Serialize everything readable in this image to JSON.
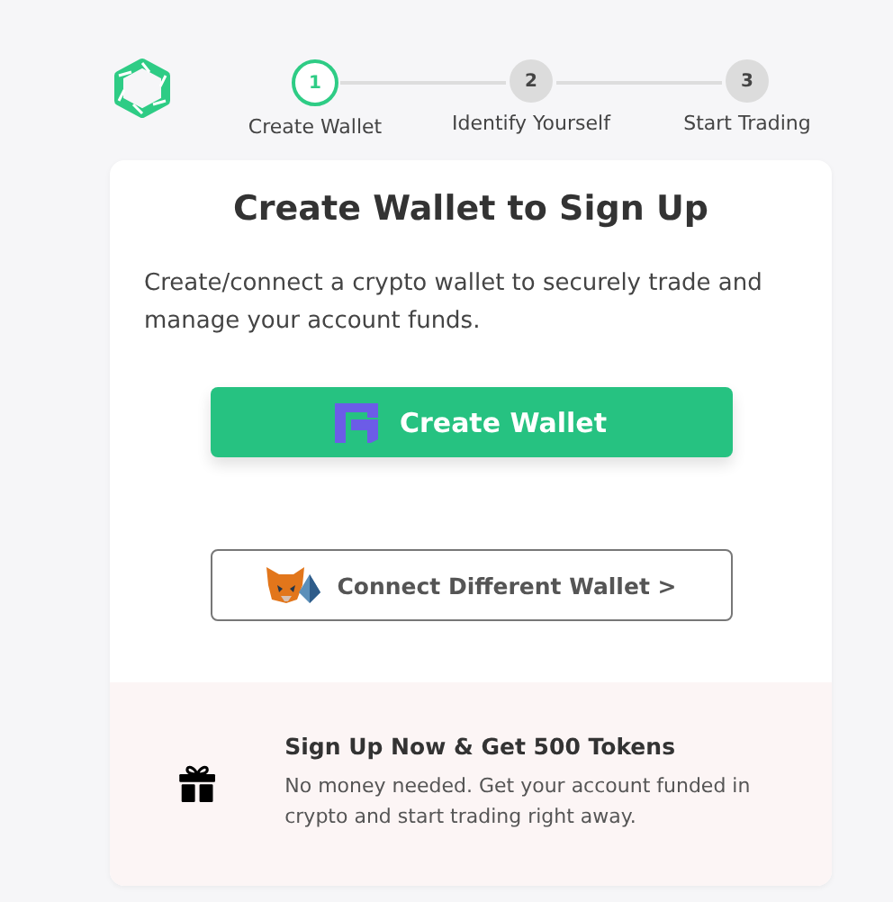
{
  "steps": [
    {
      "number": "1",
      "label": "Create Wallet",
      "selected": true
    },
    {
      "number": "2",
      "label": "Identify Yourself",
      "selected": false
    },
    {
      "number": "3",
      "label": "Start Trading",
      "selected": false
    }
  ],
  "card": {
    "title": "Create Wallet to Sign Up",
    "description": "Create/connect a crypto wallet to securely trade and manage your account funds.",
    "primary_button": "Create Wallet",
    "secondary_button": "Connect Different Wallet >"
  },
  "promo": {
    "title": "Sign Up Now & Get 500 Tokens",
    "text": "No money needed. Get your account funded in crypto and start trading right away."
  }
}
